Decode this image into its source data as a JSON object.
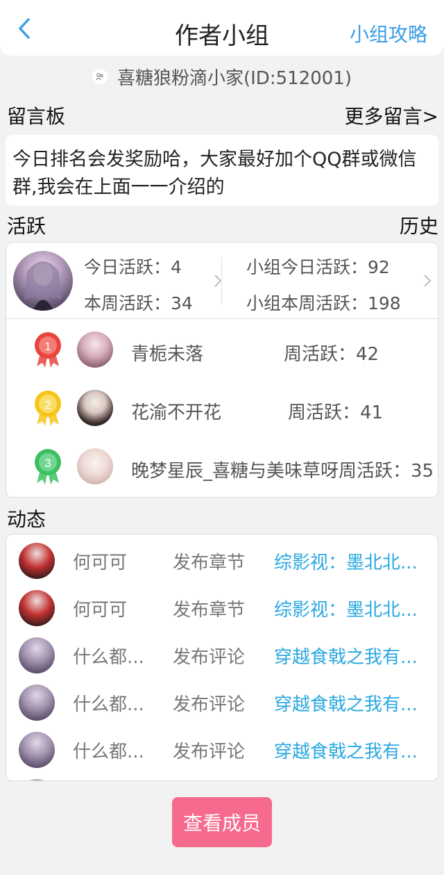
{
  "header": {
    "title": "作者小组",
    "right_link": "小组攻略"
  },
  "group": {
    "name": "喜糖狼粉滴小家(ID:512001)"
  },
  "notice": {
    "section_title": "留言板",
    "more_link": "更多留言>",
    "text": "今日排名会发奖励哈，大家最好加个QQ群或微信群,我会在上面一一介绍的"
  },
  "active": {
    "section_title": "活跃",
    "history_link": "历史",
    "my_today": "今日活跃：4",
    "my_week": "本周活跃：34",
    "group_today": "小组今日活跃：92",
    "group_week": "小组本周活跃：198",
    "ranking": [
      {
        "rank": "1",
        "name": "青栀未落",
        "score": "周活跃：42",
        "medal_color": "#e8453c"
      },
      {
        "rank": "2",
        "name": "花渝不开花",
        "score": "周活跃：41",
        "medal_color": "#f5c518"
      },
      {
        "rank": "3",
        "name": "晚梦星辰_喜糖与美味草呀",
        "score": "周活跃：35",
        "medal_color": "#3dbf62"
      }
    ]
  },
  "feed": {
    "section_title": "动态",
    "items": [
      {
        "user": "何可可",
        "action": "发布章节",
        "target": "综影视：墨北北..."
      },
      {
        "user": "何可可",
        "action": "发布章节",
        "target": "综影视：墨北北..."
      },
      {
        "user": "什么都...",
        "action": "发布评论",
        "target": "穿越食戟之我有..."
      },
      {
        "user": "什么都...",
        "action": "发布评论",
        "target": "穿越食戟之我有..."
      },
      {
        "user": "什么都...",
        "action": "发布评论",
        "target": "穿越食戟之我有..."
      }
    ]
  },
  "footer": {
    "members_button": "查看成员"
  },
  "colors": {
    "accent_blue": "#3a9ee5",
    "link_cyan": "#29a8e0",
    "button_pink": "#f66a8e"
  }
}
